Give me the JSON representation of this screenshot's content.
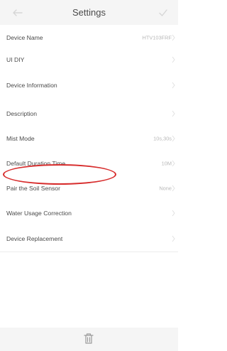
{
  "header": {
    "title": "Settings",
    "back_icon": "arrow-left-icon",
    "confirm_icon": "check-icon"
  },
  "settings": [
    {
      "label": "Device Name",
      "value": "HTV103FRF"
    },
    {
      "label": "UI DIY",
      "value": ""
    },
    {
      "label": "Device Information",
      "value": ""
    },
    {
      "label": "Description",
      "value": ""
    },
    {
      "label": "Mist Mode",
      "value": "10s,30s"
    },
    {
      "label": "Default Duration Time",
      "value": "10M"
    },
    {
      "label": "Pair the Soil Sensor",
      "value": "None"
    },
    {
      "label": "Water Usage Correction",
      "value": ""
    },
    {
      "label": "Device Replacement",
      "value": ""
    }
  ],
  "footer": {
    "delete_icon": "trash-icon"
  },
  "colors": {
    "highlight": "#d72c2c",
    "header_bg": "#f5f5f5",
    "value_text": "#b8b8b8"
  }
}
